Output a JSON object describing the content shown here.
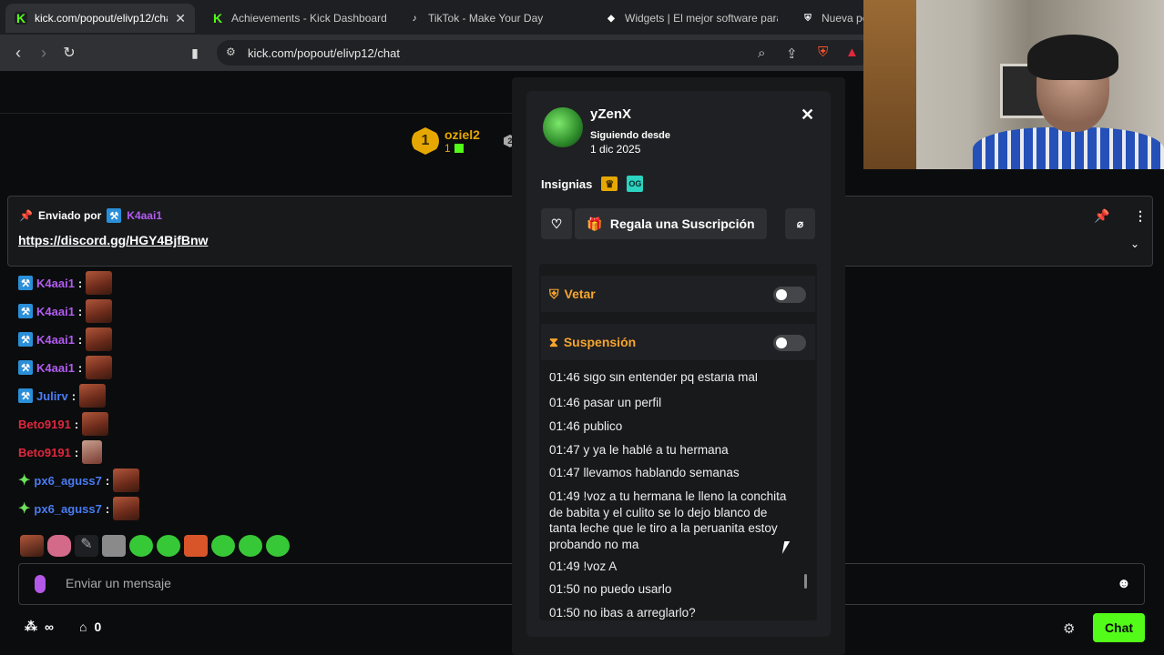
{
  "browser": {
    "tabs": [
      {
        "title": "kick.com/popout/elivp12/cha",
        "icon": "kick-logo-icon",
        "active": true
      },
      {
        "title": "Achievements - Kick Dashboard",
        "icon": "kick-logo-icon"
      },
      {
        "title": "TikTok - Make Your Day",
        "icon": "tiktok-logo-icon"
      },
      {
        "title": "Widgets | El mejor software para p",
        "icon": "widgets-logo-icon"
      },
      {
        "title": "Nueva pe",
        "icon": "shield-icon"
      }
    ],
    "url": "kick.com/popout/elivp12/chat"
  },
  "leaderboard": {
    "name": "oziel2",
    "rank": "1",
    "count": "1",
    "rank2": "2"
  },
  "pinned": {
    "label": "Enviado por",
    "user": "K4aai1",
    "link": "https://discord.gg/HGY4BjfBnw"
  },
  "chat": {
    "lines": [
      {
        "user": "K4aai1",
        "color": "#b15cf0"
      },
      {
        "user": "K4aai1",
        "color": "#b15cf0"
      },
      {
        "user": "K4aai1",
        "color": "#b15cf0"
      },
      {
        "user": "K4aai1",
        "color": "#b15cf0"
      },
      {
        "user": "Julirv",
        "color": "#4a7cf5"
      },
      {
        "user": "Beto9191",
        "color": "#e0283e"
      },
      {
        "user": "Beto9191",
        "color": "#e0283e"
      },
      {
        "user": "px6_aguss7",
        "color": "#4a7cf5"
      },
      {
        "user": "px6_aguss7",
        "color": "#4a7cf5"
      }
    ]
  },
  "composer": {
    "placeholder": "Enviar un mensaje",
    "send_label": "Chat"
  },
  "footer": {
    "count_a": "∞",
    "count_b": "0"
  },
  "profile": {
    "username": "yZenX",
    "following_label": "Siguiendo desde",
    "following_date": "1 dic 2025",
    "badges_label": "Insignias",
    "badge_og": "OG",
    "gift_label": "Regala una Suscripción",
    "ban_label": "Vetar",
    "timeout_label": "Suspensión",
    "history_top": "01:46 sigo sin entender pq estaria mal",
    "history": [
      "01:46 pasar un perfil",
      "01:46 publico",
      "01:47 y ya le hablé a tu hermana",
      "01:47 llevamos hablando semanas",
      "01:49 !voz a tu hermana le lleno la conchita de babita y el culito se lo dejo blanco de tanta leche que le tiro a la peruanita estoy probando no ma",
      "01:49 !voz A",
      "01:50 no puedo usarlo",
      "01:50 no ibas a arreglarlo?"
    ]
  }
}
